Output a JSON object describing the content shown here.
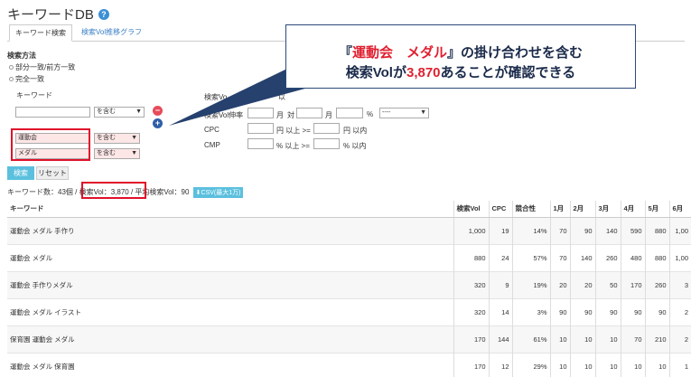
{
  "header": {
    "title": "キーワードDB",
    "help_icon": "?"
  },
  "tabs": [
    {
      "label": "キーワード検索"
    },
    {
      "label": "検索Vol推移グラフ"
    }
  ],
  "form": {
    "search_method_label": "検索方法",
    "radio_partial": "部分一致/前方一致",
    "radio_exact": "完全一致",
    "keyword_label": "キーワード",
    "keyword_value": "",
    "match_option": "を含む",
    "rows": [
      {
        "keyword": "運動会",
        "option": "を含む"
      },
      {
        "keyword": "メダル",
        "option": "を含む"
      }
    ],
    "minus_icon": "−",
    "plus_icon": "+",
    "search_vol_label": "検索Vo",
    "search_vol_suffix": "以",
    "vol_change_label": "検索Vol伸率",
    "month_label1": "月",
    "vs_label": "対",
    "month_label2": "月",
    "percent_label": "%",
    "vol_change_select": "----",
    "cpc_label": "CPC",
    "cpc_unit_from": "円 以上 >=",
    "cpc_unit_to": "円 以内",
    "cmp_label": "CMP",
    "cmp_unit_from": "% 以上 >=",
    "cmp_unit_to": "% 以内",
    "search_button": "検索",
    "reset_button": "リセット"
  },
  "summary": {
    "count_text": "キーワード数：43個 /",
    "volume_text": "検索Vol：3,870",
    "avg_text": "/ 平均検索Vol：90",
    "csv_button": "CSV(最大1万)"
  },
  "table": {
    "headers": [
      "キーワード",
      "検索Vol",
      "CPC",
      "競合性",
      "1月",
      "2月",
      "3月",
      "4月",
      "5月",
      "6月"
    ],
    "rows": [
      [
        "運動会 メダル 手作り",
        "1,000",
        "19",
        "14%",
        "70",
        "90",
        "140",
        "590",
        "880",
        "1,00"
      ],
      [
        "運動会 メダル",
        "880",
        "24",
        "57%",
        "70",
        "140",
        "260",
        "480",
        "880",
        "1,00"
      ],
      [
        "運動会 手作りメダル",
        "320",
        "9",
        "19%",
        "20",
        "20",
        "50",
        "170",
        "260",
        "3"
      ],
      [
        "運動会 メダル イラスト",
        "320",
        "14",
        "3%",
        "90",
        "90",
        "90",
        "90",
        "90",
        "2"
      ],
      [
        "保育園 運動会 メダル",
        "170",
        "144",
        "61%",
        "10",
        "10",
        "10",
        "70",
        "210",
        "2"
      ],
      [
        "運動会 メダル 保育園",
        "170",
        "12",
        "29%",
        "10",
        "10",
        "10",
        "10",
        "10",
        "1"
      ]
    ]
  },
  "callout": {
    "line1_prefix": "『",
    "line1_highlight": "運動会　メダル",
    "line1_suffix": "』の掛け合わせを含む",
    "line2_prefix": "検索Volが",
    "line2_highlight": "3,870",
    "line2_suffix": "あることが確認できる"
  },
  "colors": {
    "accent": "#5bc0de",
    "highlight_red": "#e0102a",
    "callout_border": "#2b4a7a",
    "link_blue": "#3b7fc4"
  }
}
